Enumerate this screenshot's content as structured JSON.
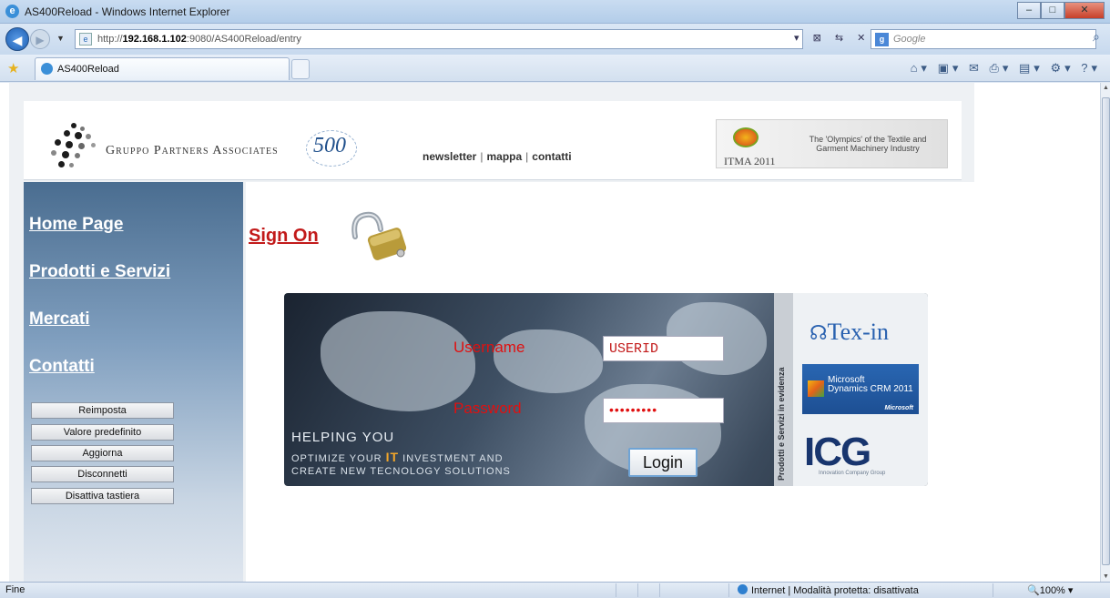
{
  "window": {
    "title": "AS400Reload - Windows Internet Explorer"
  },
  "address": {
    "url_prefix": "http://",
    "url_host": "192.168.1.102",
    "url_rest": ":9080/AS400Reload/entry"
  },
  "search": {
    "placeholder": "Google"
  },
  "tab": {
    "label": "AS400Reload"
  },
  "header": {
    "company": "Gruppo Partners Associates",
    "badge": "500",
    "links": [
      "newsletter",
      "mappa",
      "contatti"
    ],
    "itma_label": "ITMA 2011",
    "itma_tagline": "The 'Olympics' of the Textile and Garment Machinery Industry"
  },
  "nav": {
    "links": [
      "Home Page",
      "Prodotti e Servizi",
      "Mercati",
      "Contatti"
    ],
    "buttons": [
      "Reimposta",
      "Valore predefinito",
      "Aggiorna",
      "Disconnetti",
      "Disattiva tastiera"
    ]
  },
  "signon": {
    "title": "Sign On",
    "username_label": "Username",
    "username_value": "USERID",
    "password_label": "Password",
    "password_value": "•••••••••",
    "login_label": "Login",
    "tagline_1": "HELPING YOU",
    "tagline_2a": "OPTIMIZE YOUR ",
    "tagline_2b": "IT",
    "tagline_2c": " INVESTMENT AND",
    "tagline_3": "CREATE NEW TECNOLOGY SOLUTIONS",
    "side_text": "Prodotti e Servizi in evidenza",
    "logo_texin": "Tex-in",
    "logo_ms_1": "Microsoft",
    "logo_ms_2": "Dynamics CRM 2011",
    "logo_ms_3": "Microsoft",
    "logo_icg": "ICG",
    "logo_icg_sub": "Innovation Company Group"
  },
  "status": {
    "left": "Fine",
    "zone": "Internet | Modalità protetta: disattivata",
    "zoom": "100%"
  },
  "colors": {
    "accent_red": "#c21a1a",
    "nav_blue": "#4a6d90"
  }
}
